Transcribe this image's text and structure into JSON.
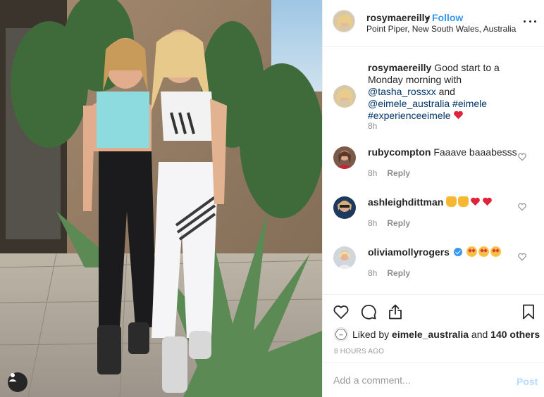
{
  "post": {
    "username": "rosymaereilly",
    "separator": "•",
    "follow_label": "Follow",
    "location": "Point Piper, New South Wales, Australia"
  },
  "caption": {
    "username": "rosymaereilly",
    "text_1": "Good start to a Monday morning with",
    "mention_1": "@tasha_rossxx",
    "and": "and",
    "mention_2": "@eimele_australia",
    "hashtag_1": "#eimele",
    "hashtag_2": "#experienceeimele",
    "emoji": "heart",
    "time": "8h"
  },
  "comments": [
    {
      "username": "rubycompton",
      "text": "Faaave baaabesss",
      "emojis": [],
      "verified": false,
      "time": "8h",
      "reply_label": "Reply"
    },
    {
      "username": "ashleighdittman",
      "text": "",
      "emojis": [
        "pray",
        "pray",
        "heart",
        "heart"
      ],
      "verified": false,
      "time": "8h",
      "reply_label": "Reply"
    },
    {
      "username": "oliviamollyrogers",
      "text": "",
      "emojis": [
        "star-eyes",
        "star-eyes",
        "star-eyes"
      ],
      "verified": true,
      "time": "8h",
      "reply_label": "Reply"
    }
  ],
  "actions": {
    "icons": [
      "heart-outline-icon",
      "comment-icon",
      "share-icon",
      "bookmark-icon"
    ],
    "liked_by_prefix": "Liked by",
    "liked_by_user": "eimele_australia",
    "liked_by_and": "and",
    "liked_by_others": "140 others",
    "timestamp": "8 HOURS AGO"
  },
  "add_comment": {
    "placeholder": "Add a comment...",
    "post_label": "Post"
  },
  "colors": {
    "link_blue": "#3897f0",
    "mention": "#003569",
    "muted": "#8e8e8e",
    "post_disabled": "#b3dbff",
    "heart_red": "#ed4956"
  }
}
